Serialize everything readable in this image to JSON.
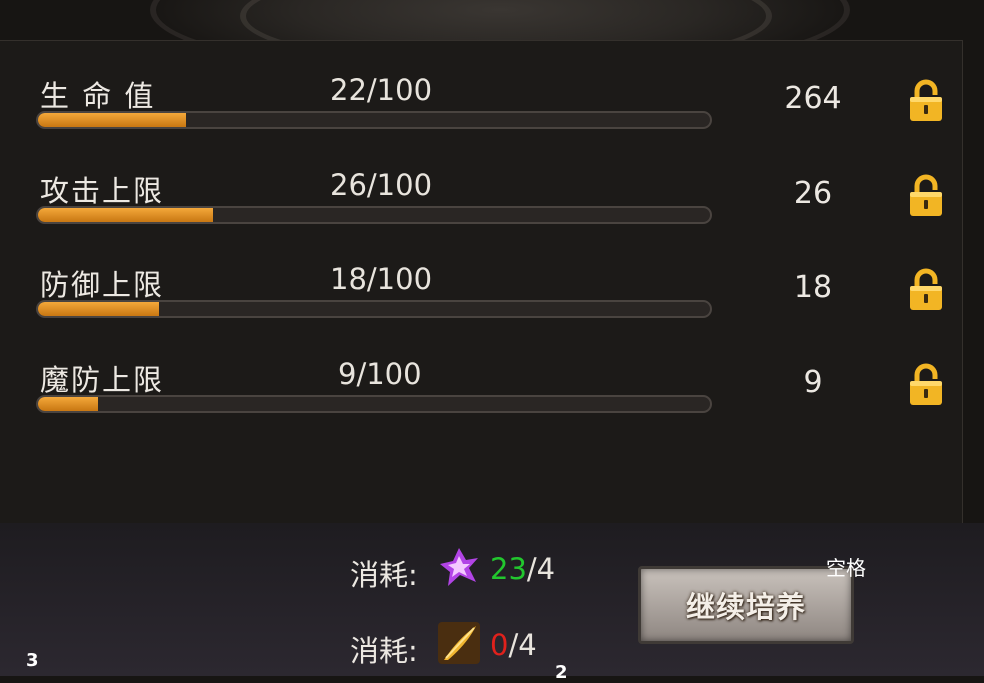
{
  "stats": [
    {
      "label": "生 命 值",
      "progress": "22/100",
      "fill": 0.22,
      "value": "264"
    },
    {
      "label": "攻击上限",
      "progress": "26/100",
      "fill": 0.26,
      "value": "26"
    },
    {
      "label": "防御上限",
      "progress": "18/100",
      "fill": 0.18,
      "value": "18"
    },
    {
      "label": "魔防上限",
      "progress": "9/100",
      "fill": 0.09,
      "value": "9"
    }
  ],
  "costs": [
    {
      "label": "消耗:",
      "icon": "purple-crystal-icon",
      "have": "23",
      "need": "/4",
      "have_color": "#22c72e"
    },
    {
      "label": "消耗:",
      "icon": "golden-feather-icon",
      "have": "0",
      "need": "/4",
      "have_color": "#e0211c"
    }
  ],
  "continue_button": {
    "label": "继续培养",
    "hotkey": "空格"
  },
  "corner_left": "3",
  "corner_mid": "2",
  "colors": {
    "bar_fill": "#e8961f",
    "lock": "#f2b524",
    "sufficient": "#22c72e",
    "insufficient": "#e0211c"
  }
}
